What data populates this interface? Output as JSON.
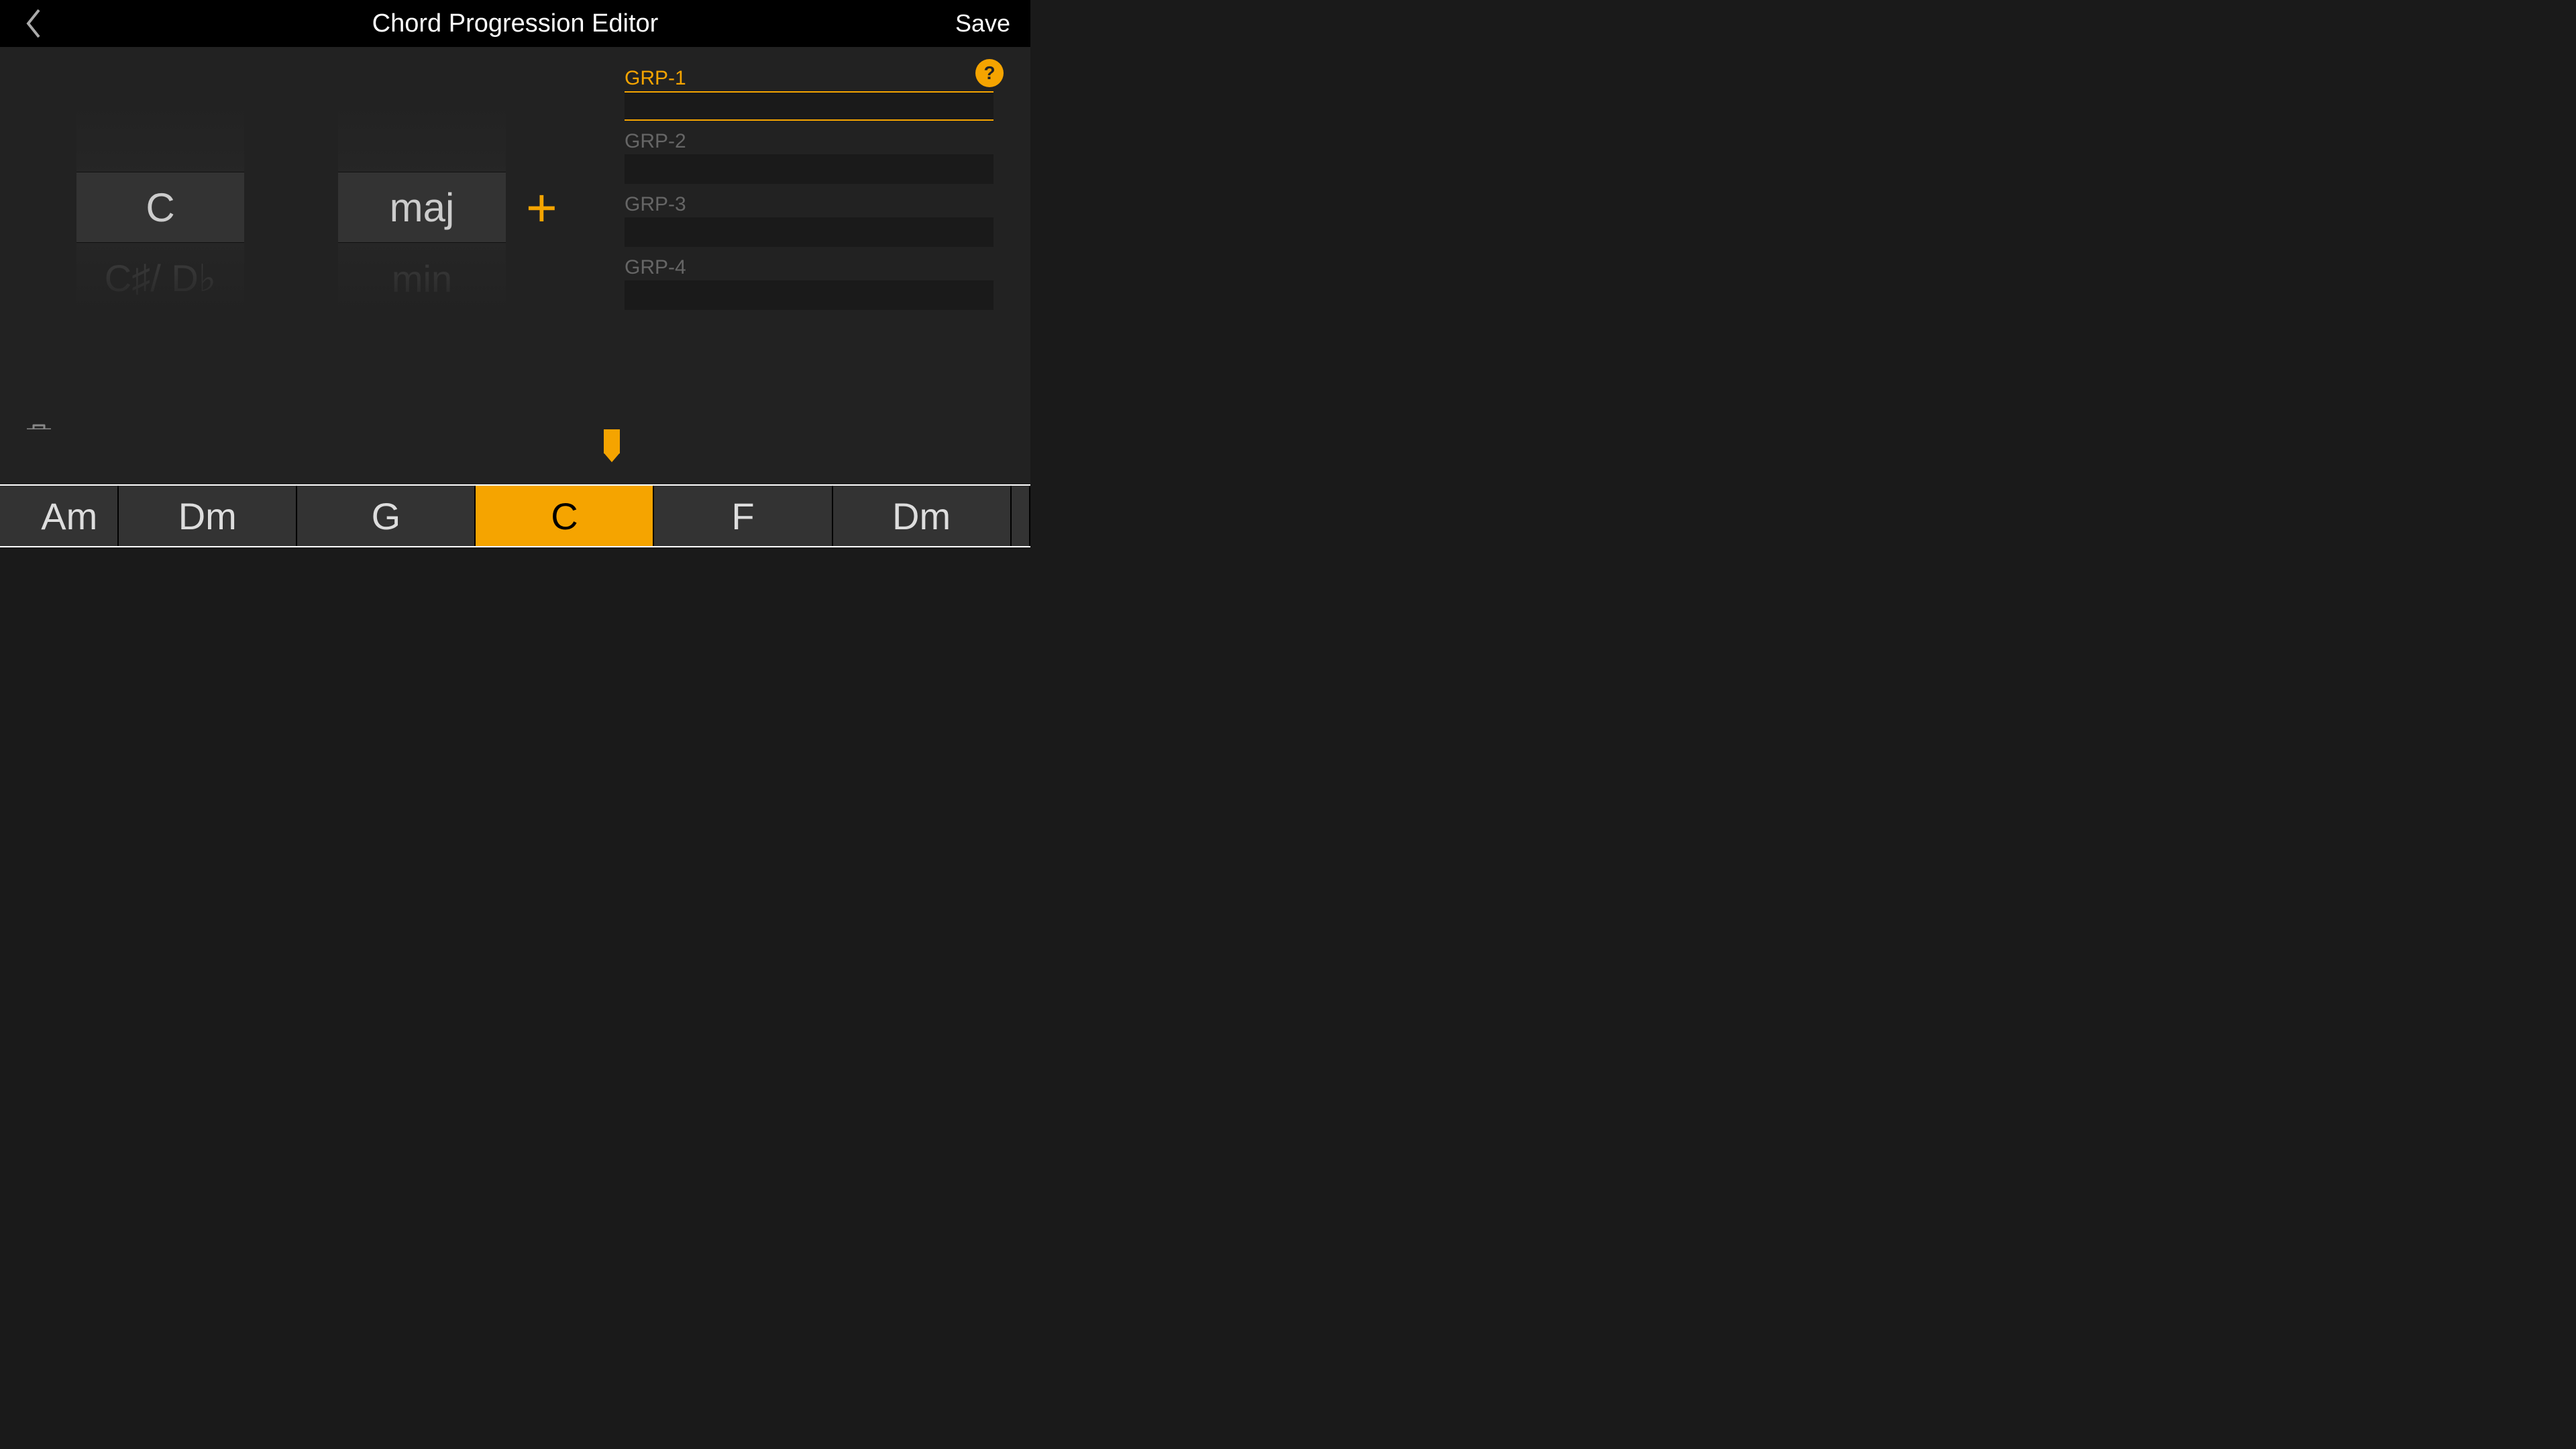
{
  "header": {
    "title": "Chord Progression Editor",
    "save_label": "Save"
  },
  "help_label": "?",
  "picker": {
    "root": {
      "selected": "C",
      "below": "C♯/ D♭"
    },
    "quality": {
      "selected": "maj",
      "below": "min"
    }
  },
  "add_symbol": "+",
  "groups": [
    {
      "label": "GRP-1",
      "selected": true
    },
    {
      "label": "GRP-2",
      "selected": false
    },
    {
      "label": "GRP-3",
      "selected": false
    },
    {
      "label": "GRP-4",
      "selected": false
    }
  ],
  "chord_rail": [
    {
      "label": "Am",
      "partial": true,
      "selected": false
    },
    {
      "label": "Dm",
      "partial": false,
      "selected": false
    },
    {
      "label": "G",
      "partial": false,
      "selected": false
    },
    {
      "label": "C",
      "partial": false,
      "selected": true
    },
    {
      "label": "F",
      "partial": false,
      "selected": false
    },
    {
      "label": "Dm",
      "partial": false,
      "selected": false
    }
  ],
  "colors": {
    "accent": "#f5a400",
    "bg": "#1a1a1a",
    "panel": "#222"
  }
}
